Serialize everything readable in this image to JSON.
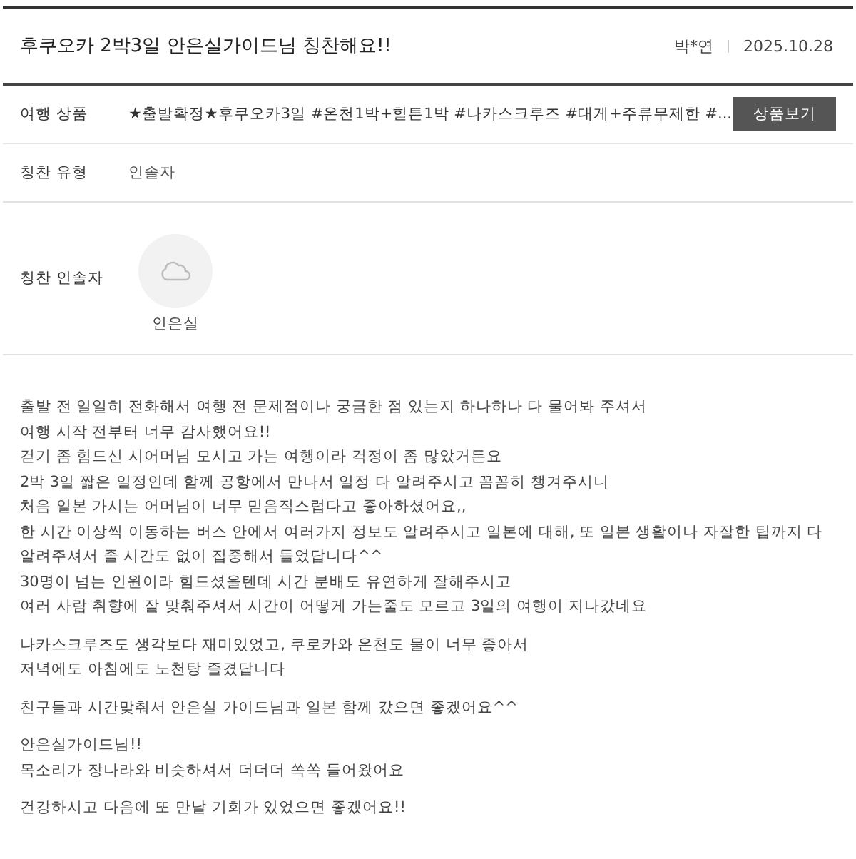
{
  "title": "후쿠오카 2박3일 안은실가이드님 칭찬해요!!",
  "author": "박*연",
  "date": "2025.10.28",
  "fields": [
    {
      "kind": "product",
      "label": "여행 상품",
      "value": "★출발확정★후쿠오카3일 #온천1박+힐튼1박 #나카스크루즈 #대게+주류무제한 #...",
      "button": "상품보기"
    },
    {
      "kind": "text",
      "label": "칭찬 유형",
      "value": "인솔자"
    },
    {
      "kind": "guide",
      "label": "칭찬 인솔자",
      "name": "인은실"
    }
  ],
  "body": [
    [
      "출발 전 일일히 전화해서 여행 전 문제점이나 궁금한 점 있는지 하나하나 다 물어봐 주셔서",
      "여행 시작 전부터 너무 감사했어요!!",
      "걷기 좀 힘드신 시어머님 모시고 가는 여행이라 걱정이 좀 많았거든요",
      "2박 3일 짧은 일정인데 함께 공항에서 만나서 일정 다 알려주시고 꼼꼼히 챙겨주시니",
      "처음 일본 가시는 어머님이 너무 믿음직스럽다고 좋아하셨어요,,",
      "한 시간 이상씩 이동하는 버스 안에서 여러가지 정보도 알려주시고 일본에 대해, 또 일본 생활이나 자잘한 팁까지 다 알려주셔서 졸 시간도 없이 집중해서 들었답니다^^",
      "30명이 넘는 인원이라 힘드셨을텐데 시간 분배도 유연하게 잘해주시고",
      "여러 사람 취향에 잘 맞춰주셔서 시간이 어떻게 가는줄도 모르고 3일의 여행이 지나갔네요"
    ],
    [
      "나카스크루즈도 생각보다 재미있었고, 쿠로카와 온천도 물이 너무 좋아서",
      "저녁에도 아침에도 노천탕 즐겼답니다"
    ],
    [
      "친구들과 시간맞춰서 안은실 가이드님과 일본 함께 갔으면 좋겠어요^^"
    ],
    [
      "안은실가이드님!!",
      "목소리가 장나라와 비슷하셔서 더더더 쏙쏙 들어왔어요"
    ],
    [
      "건강하시고 다음에 또 만날 기회가 있었으면 좋겠어요!!"
    ]
  ]
}
